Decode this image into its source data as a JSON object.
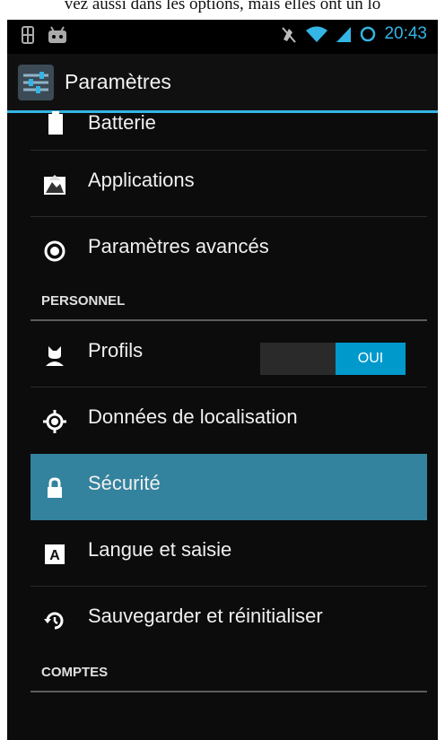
{
  "page_caption": "vez aussi dans les options, mais elles ont un lo",
  "status_bar": {
    "time": "20:43"
  },
  "action_bar": {
    "title": "Paramètres"
  },
  "list": {
    "battery_label": "Batterie",
    "apps_label": "Applications",
    "advanced_label": "Paramètres avancés",
    "section_personal": "PERSONNEL",
    "profiles_label": "Profils",
    "profiles_toggle": "OUI",
    "location_label": "Données de localisation",
    "security_label": "Sécurité",
    "language_label": "Langue et saisie",
    "backup_label": "Sauvegarder et réinitialiser",
    "section_accounts": "COMPTES"
  },
  "colors": {
    "accent": "#33b5e5",
    "selected_row": "#33839e",
    "toggle_on": "#0099cc"
  },
  "icons": [
    "phone-icon",
    "android-icon",
    "mute-icon",
    "wifi-icon",
    "signal-icon",
    "sync-icon",
    "settings-app-icon",
    "battery-icon",
    "applications-icon",
    "advanced-settings-icon",
    "profiles-icon",
    "location-icon",
    "lock-icon",
    "language-icon",
    "backup-icon"
  ]
}
